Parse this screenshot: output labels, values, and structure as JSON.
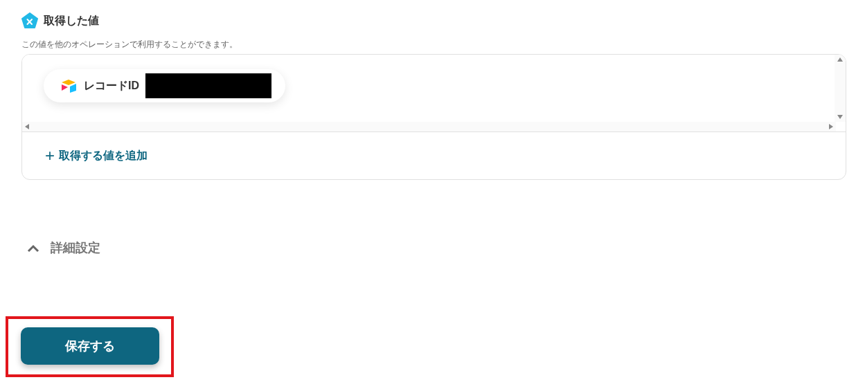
{
  "section": {
    "title": "取得した値",
    "description": "この値を他のオペレーションで利用することができます。"
  },
  "values": [
    {
      "label": "レコードID",
      "redacted": true
    }
  ],
  "add_button": {
    "icon": "+",
    "label": "取得する値を追加"
  },
  "details": {
    "label": "詳細設定",
    "expanded": true
  },
  "save_button": {
    "label": "保存する",
    "highlighted": true
  }
}
